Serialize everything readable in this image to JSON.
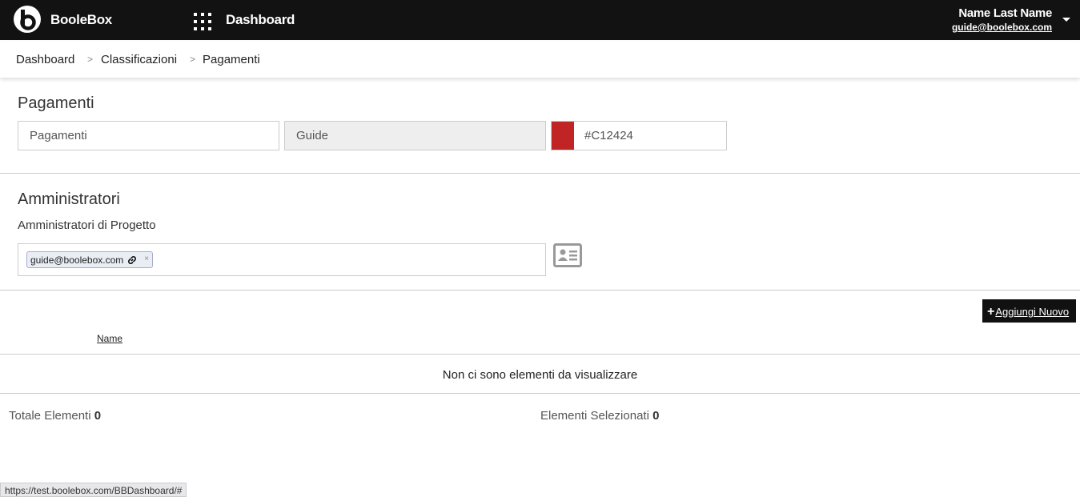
{
  "header": {
    "brand": "BooleBox",
    "nav_title": "Dashboard",
    "user_name": "Name Last Name",
    "user_email": "guide@boolebox.com"
  },
  "breadcrumb": {
    "items": [
      "Dashboard",
      "Classificazioni",
      "Pagamenti"
    ],
    "separator": ">"
  },
  "classification": {
    "title": "Pagamenti",
    "name_value": "Pagamenti",
    "category_value": "Guide",
    "color_hex": "#C12424",
    "color_swatch": "#C12424"
  },
  "admins": {
    "title": "Amministratori",
    "label": "Amministratori di Progetto",
    "tags": [
      "guide@boolebox.com"
    ],
    "remove_symbol": "×"
  },
  "table": {
    "add_button_label": "Aggiungi Nuovo",
    "add_button_icon": "plus-icon",
    "column_name": "Name",
    "empty_message": "Non ci sono elementi da visualizzare"
  },
  "footer": {
    "total_label": "Totale Elementi",
    "total_value": "0",
    "selected_label": "Elementi Selezionati",
    "selected_value": "0"
  },
  "status_bar": {
    "url": "https://test.boolebox.com/BBDashboard/#"
  }
}
